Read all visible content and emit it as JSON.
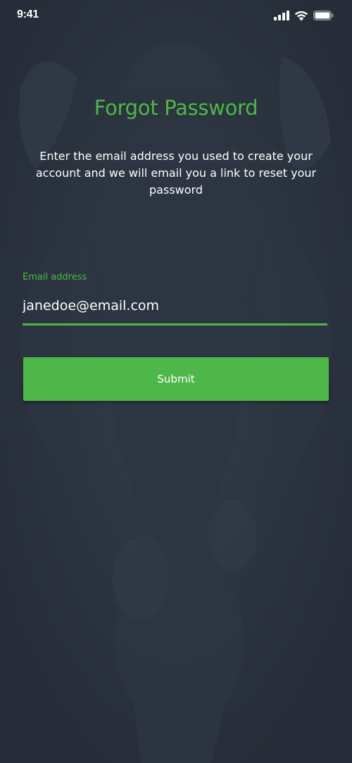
{
  "status_bar": {
    "time": "9:41",
    "icons": [
      "cellular-signal-icon",
      "wifi-icon",
      "battery-icon"
    ]
  },
  "screen": {
    "title": "Forgot Password",
    "subtitle": "Enter the email address you used to create your account and we will email you a link to reset your password",
    "email_label": "Email address",
    "email_value": "janedoe@email.com",
    "submit_label": "Submit"
  },
  "colors": {
    "accent": "#4cb848",
    "background": "#28303b",
    "text": "#ffffff"
  }
}
